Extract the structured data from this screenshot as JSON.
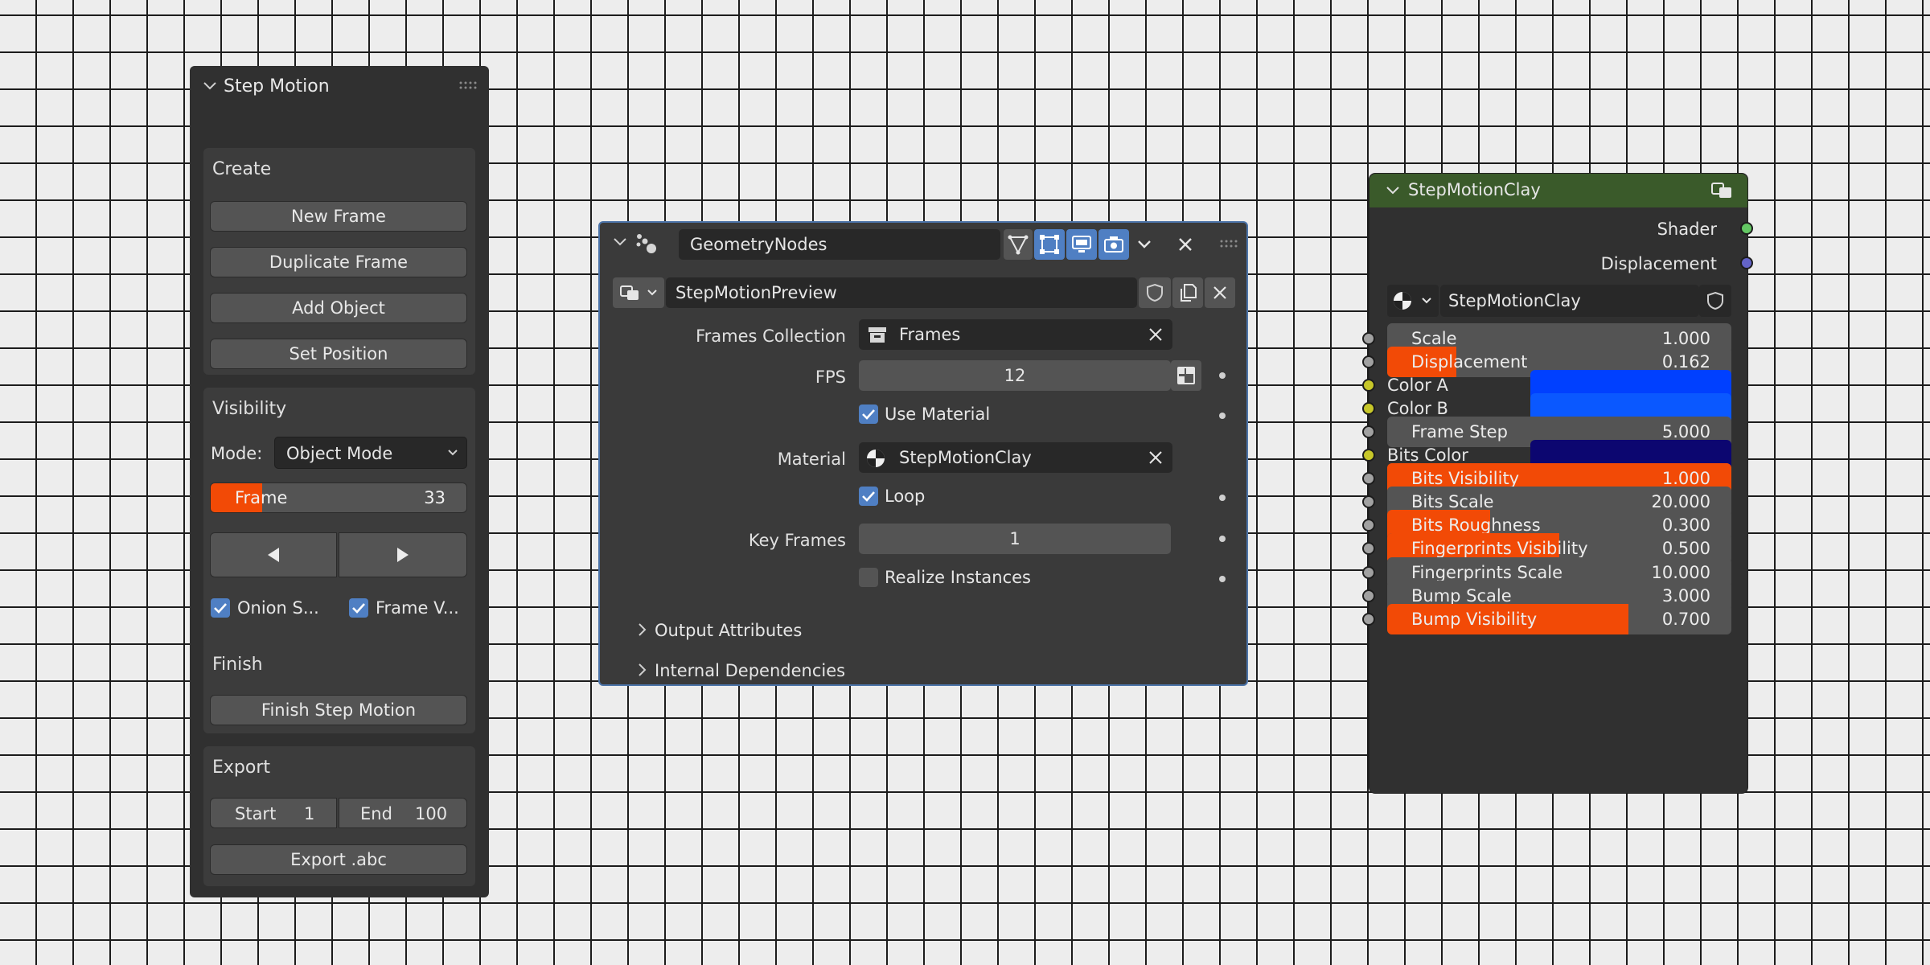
{
  "step_motion": {
    "title": "Step Motion",
    "create": {
      "title": "Create",
      "buttons": [
        "New Frame",
        "Duplicate Frame",
        "Add Object",
        "Set Position"
      ]
    },
    "visibility": {
      "title": "Visibility",
      "mode_label": "Mode:",
      "mode_value": "Object Mode",
      "frame_label": "Frame",
      "frame_value": "33",
      "frame_fill": 0.2,
      "prev_icon": "triangle-left-icon",
      "next_icon": "triangle-right-icon",
      "onion_label": "Onion S...",
      "onion_checked": true,
      "frame_vis_label": "Frame V...",
      "frame_vis_checked": true
    },
    "finish": {
      "title": "Finish",
      "button": "Finish Step Motion"
    },
    "export": {
      "title": "Export",
      "start_label": "Start",
      "start_value": "1",
      "end_label": "End",
      "end_value": "100",
      "button": "Export .abc"
    }
  },
  "geometry_nodes": {
    "modifier_name": "GeometryNodes",
    "node_group": "StepMotionPreview",
    "props": {
      "frames_collection_label": "Frames Collection",
      "frames_collection_value": "Frames",
      "fps_label": "FPS",
      "fps_value": "12",
      "use_material_label": "Use Material",
      "use_material_checked": true,
      "material_label": "Material",
      "material_value": "StepMotionClay",
      "loop_label": "Loop",
      "loop_checked": true,
      "key_frames_label": "Key Frames",
      "key_frames_value": "1",
      "realize_label": "Realize Instances",
      "realize_checked": false
    },
    "sections": [
      "Output Attributes",
      "Internal Dependencies"
    ]
  },
  "material_node": {
    "title": "StepMotionClay",
    "outputs": [
      "Shader",
      "Displacement"
    ],
    "material_name": "StepMotionClay",
    "rows": [
      {
        "kind": "slider",
        "label": "Scale",
        "value": "1.000",
        "fill": 0.0
      },
      {
        "kind": "slider",
        "label": "Displacement",
        "value": "0.162",
        "fill": 0.2
      },
      {
        "kind": "color",
        "label": "Color A",
        "color": "#0040ff"
      },
      {
        "kind": "color",
        "label": "Color B",
        "color": "#0a58ff"
      },
      {
        "kind": "slider",
        "label": "Frame Step",
        "value": "5.000",
        "fill": 0.0
      },
      {
        "kind": "color",
        "label": "Bits Color",
        "color": "#0c0670"
      },
      {
        "kind": "slider",
        "label": "Bits Visibility",
        "value": "1.000",
        "fill": 1.0
      },
      {
        "kind": "slider",
        "label": "Bits Scale",
        "value": "20.000",
        "fill": 0.0
      },
      {
        "kind": "slider",
        "label": "Bits Roughness",
        "value": "0.300",
        "fill": 0.3
      },
      {
        "kind": "slider",
        "label": "Fingerprints Visibility",
        "value": "0.500",
        "fill": 0.5
      },
      {
        "kind": "slider",
        "label": "Fingerprints Scale",
        "value": "10.000",
        "fill": 0.0
      },
      {
        "kind": "slider",
        "label": "Bump Scale",
        "value": "3.000",
        "fill": 0.0
      },
      {
        "kind": "slider",
        "label": "Bump Visibility",
        "value": "0.700",
        "fill": 0.7
      }
    ]
  },
  "colors": {
    "accent_orange": "#f24a06",
    "checkbox_blue": "#4f7fc3",
    "node_header": "#3a5a2a",
    "socket_gray": "#a1a1a1",
    "socket_yellow": "#c7c729",
    "socket_green": "#63c763",
    "socket_purple": "#6363c7"
  }
}
